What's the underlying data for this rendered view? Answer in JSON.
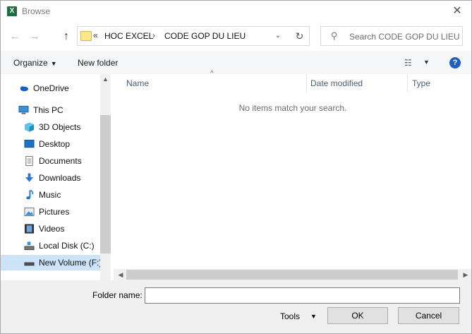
{
  "window": {
    "title": "Browse",
    "app_icon_letter": "X"
  },
  "address_bar": {
    "overflow": "«",
    "breadcrumbs": [
      "HOC EXCEL",
      "CODE GOP DU LIEU"
    ],
    "separator": "›"
  },
  "search": {
    "placeholder": "Search CODE GOP DU LIEU"
  },
  "toolbar": {
    "organize": "Organize",
    "new_folder": "New folder"
  },
  "nav_pane": {
    "items": [
      {
        "label": "OneDrive",
        "icon": "cloud-icon"
      },
      {
        "label": "This PC",
        "icon": "computer-icon"
      },
      {
        "label": "3D Objects",
        "icon": "cube-icon"
      },
      {
        "label": "Desktop",
        "icon": "desktop-icon"
      },
      {
        "label": "Documents",
        "icon": "document-icon"
      },
      {
        "label": "Downloads",
        "icon": "download-icon"
      },
      {
        "label": "Music",
        "icon": "music-note-icon"
      },
      {
        "label": "Pictures",
        "icon": "picture-icon"
      },
      {
        "label": "Videos",
        "icon": "film-icon"
      },
      {
        "label": "Local Disk (C:)",
        "icon": "drive-icon"
      },
      {
        "label": "New Volume (F:)",
        "icon": "drive-icon",
        "selected": true
      }
    ]
  },
  "content": {
    "columns": [
      "Name",
      "Date modified",
      "Type"
    ],
    "empty_message": "No items match your search."
  },
  "footer": {
    "folder_name_label": "Folder name:",
    "folder_name_value": "",
    "tools": "Tools",
    "ok": "OK",
    "cancel": "Cancel"
  },
  "colors": {
    "selection": "#cde3f7",
    "help": "#1f5fbf",
    "excel_green": "#1d6f42"
  }
}
